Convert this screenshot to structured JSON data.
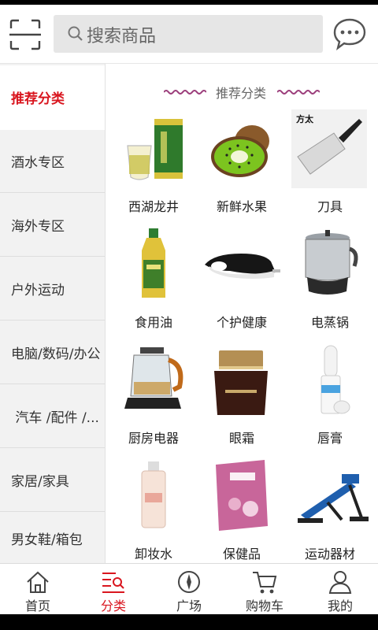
{
  "search": {
    "placeholder": "搜索商品"
  },
  "sidebar": {
    "items": [
      {
        "label": "推荐分类",
        "active": true
      },
      {
        "label": "酒水专区"
      },
      {
        "label": "海外专区"
      },
      {
        "label": "户外运动"
      },
      {
        "label": "电脑/数码/办公"
      },
      {
        "label": " 汽车 /配件 /..."
      },
      {
        "label": "家居/家具"
      },
      {
        "label": "男女鞋/箱包"
      }
    ]
  },
  "section": {
    "title": "推荐分类"
  },
  "products": [
    {
      "label": "西湖龙井",
      "icon": "tea-icon"
    },
    {
      "label": "新鲜水果",
      "icon": "kiwi-icon"
    },
    {
      "label": "刀具",
      "icon": "knife-icon"
    },
    {
      "label": "食用油",
      "icon": "oil-bottle-icon"
    },
    {
      "label": "个护健康",
      "icon": "massager-icon"
    },
    {
      "label": "电蒸锅",
      "icon": "steamer-icon"
    },
    {
      "label": "厨房电器",
      "icon": "kettle-icon"
    },
    {
      "label": "眼霜",
      "icon": "eye-cream-icon"
    },
    {
      "label": "唇膏",
      "icon": "lip-balm-icon"
    },
    {
      "label": "卸妆水",
      "icon": "makeup-remover-icon"
    },
    {
      "label": "保健品",
      "icon": "health-tea-icon"
    },
    {
      "label": "运动器材",
      "icon": "fitness-bench-icon"
    }
  ],
  "knife_brand": "方太",
  "tabs": [
    {
      "label": "首页",
      "icon": "home-icon"
    },
    {
      "label": "分类",
      "icon": "category-icon",
      "active": true
    },
    {
      "label": "广场",
      "icon": "compass-icon"
    },
    {
      "label": "购物车",
      "icon": "cart-icon"
    },
    {
      "label": "我的",
      "icon": "user-icon"
    }
  ],
  "colors": {
    "accent": "#d9161f",
    "sidebar_bg": "#f2f2f2",
    "search_bg": "#e6e6e6"
  }
}
